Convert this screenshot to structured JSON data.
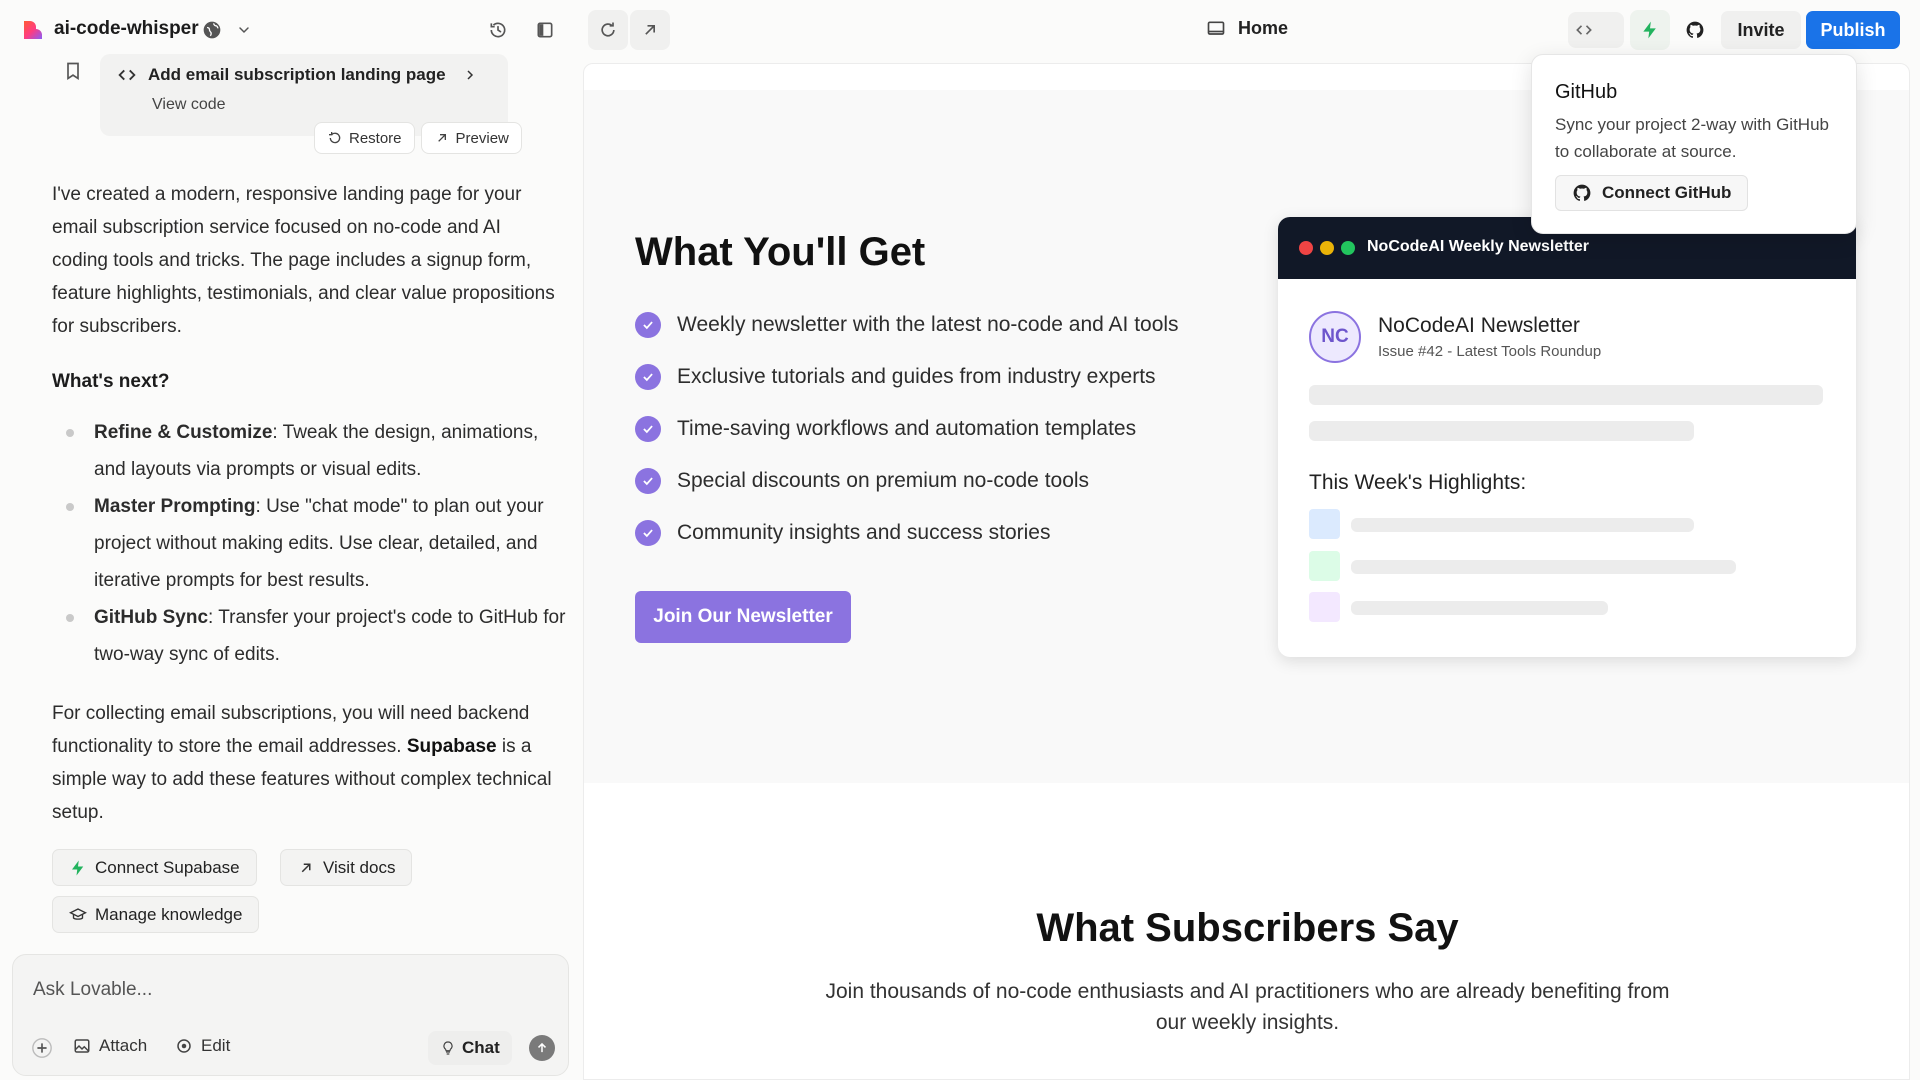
{
  "topbar": {
    "project_name": "ai-code-whisper",
    "route_label": "Home",
    "invite_label": "Invite",
    "publish_label": "Publish",
    "colors": {
      "publish": "#1a73e8",
      "accent_green": "#22b35e"
    }
  },
  "version_card": {
    "title": "Add email subscription landing page",
    "view_code": "View code",
    "restore_label": "Restore",
    "preview_label": "Preview"
  },
  "chat": {
    "intro": "I've created a modern, responsive landing page for your email subscription service focused on no-code and AI coding tools and tricks. The page includes a signup form, feature highlights, testimonials, and clear value propositions for subscribers.",
    "next_heading": "What's next?",
    "bullets": [
      {
        "bold": "Refine & Customize",
        "text": ": Tweak the design, animations, and layouts via prompts or visual edits."
      },
      {
        "bold": "Master Prompting",
        "text": ": Use \"chat mode\" to plan out your project without making edits. Use clear, detailed, and iterative prompts for best results."
      },
      {
        "bold": "GitHub Sync",
        "text": ": Transfer your project's code to GitHub for two-way sync of edits."
      }
    ],
    "supabase_p1": "For collecting email subscriptions, you will need backend functionality to store the email addresses.",
    "supabase_bold": "Supabase",
    "supabase_p2": " is a simple way to add these features without complex technical setup.",
    "connect_supabase": "Connect Supabase",
    "visit_docs": "Visit docs",
    "manage_knowledge": "Manage knowledge"
  },
  "composer": {
    "placeholder": "Ask Lovable...",
    "attach": "Attach",
    "edit": "Edit",
    "chat": "Chat"
  },
  "preview": {
    "features_title": "What You'll Get",
    "features": [
      "Weekly newsletter with the latest no-code and AI tools",
      "Exclusive tutorials and guides from industry experts",
      "Time-saving workflows and automation templates",
      "Special discounts on premium no-code tools",
      "Community insights and success stories"
    ],
    "cta": "Join Our Newsletter",
    "card": {
      "window_title": "NoCodeAI Weekly Newsletter",
      "avatar": "NC",
      "name": "NoCodeAI Newsletter",
      "issue": "Issue #42 - Latest Tools Roundup",
      "highlights_title": "This Week's Highlights:"
    },
    "testimonials_title": "What Subscribers Say",
    "testimonials_sub": "Join thousands of no-code enthusiasts and AI practitioners who are already benefiting from our weekly insights.",
    "colors": {
      "accent": "#8b73e0",
      "card_header": "#111827"
    }
  },
  "github_popover": {
    "title": "GitHub",
    "description": "Sync your project 2-way with GitHub to collaborate at source.",
    "button": "Connect GitHub"
  }
}
